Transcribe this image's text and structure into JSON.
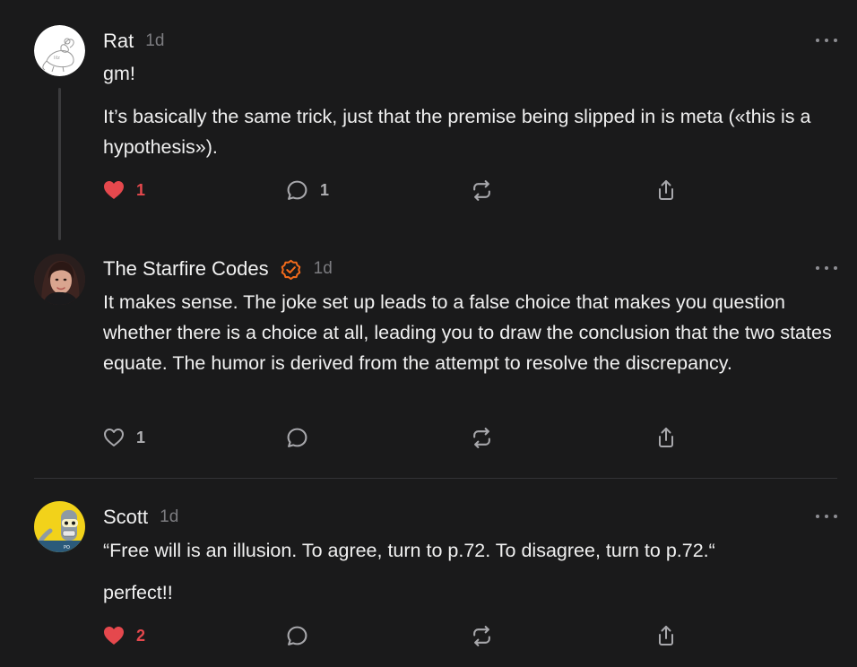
{
  "colors": {
    "background": "#1a1a1b",
    "liked_heart": "#e5484d",
    "verified_badge": "#f26a1b",
    "muted_text": "#7c7c80"
  },
  "comments": [
    {
      "author": "Rat",
      "time": "1d",
      "verified": false,
      "avatar": "rat-sketch-avatar",
      "paragraphs": [
        "gm!",
        "It’s basically the same trick, just that the premise being slipped in is meta («this is a hypothesis»)."
      ],
      "likes": {
        "count": "1",
        "liked": true
      },
      "replies": {
        "count": "1"
      }
    },
    {
      "author": "The Starfire Codes",
      "time": "1d",
      "verified": true,
      "avatar": "woman-photo-avatar",
      "paragraphs": [
        "It makes sense. The joke set up leads to a false choice that makes you question whether there is a choice at all, leading you to draw the conclusion that the two states equate. The humor is derived from the attempt to resolve the discrepancy."
      ],
      "likes": {
        "count": "1",
        "liked": false
      },
      "replies": {
        "count": ""
      }
    },
    {
      "author": "Scott",
      "time": "1d",
      "verified": false,
      "avatar": "robot-cartoon-avatar",
      "paragraphs": [
        "“Free will is an illusion. To agree, turn to p.72. To disagree, turn to p.72.“",
        "perfect!!"
      ],
      "likes": {
        "count": "2",
        "liked": true
      },
      "replies": {
        "count": ""
      }
    }
  ]
}
